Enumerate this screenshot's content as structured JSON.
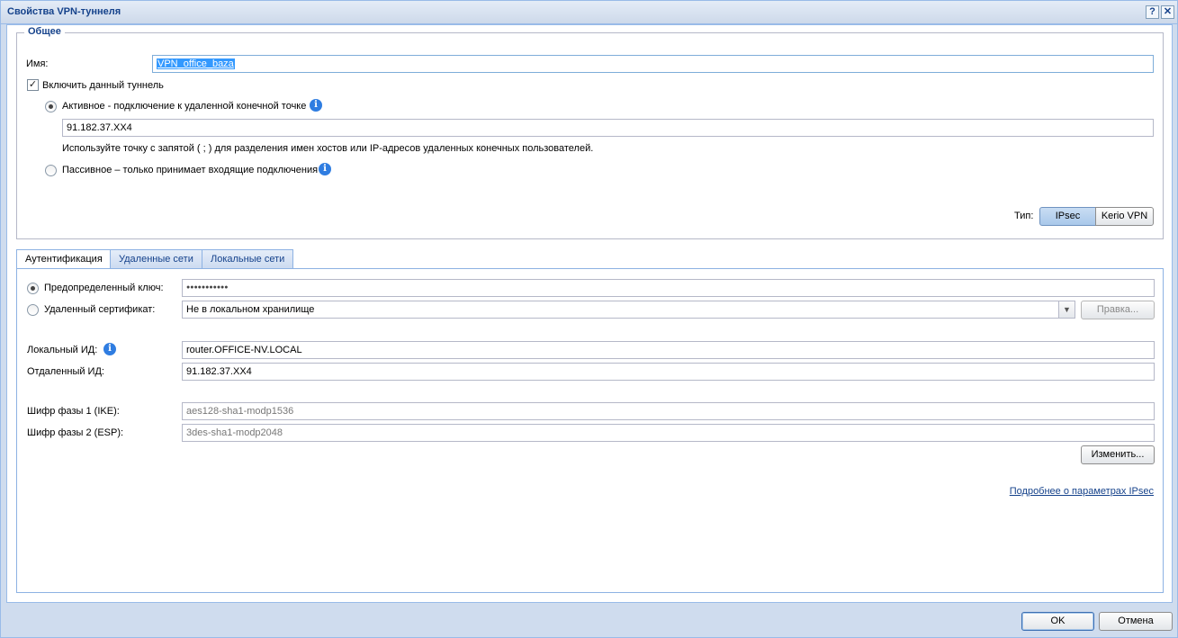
{
  "window": {
    "title": "Свойства VPN-туннеля",
    "help_glyph": "?",
    "close_glyph": "✕"
  },
  "general": {
    "legend": "Общее",
    "name_label": "Имя:",
    "name_value": "VPN_office_baza",
    "enable_label": "Включить данный туннель",
    "enable_checked": true,
    "active_label": "Активное - подключение к удаленной конечной точке",
    "active_selected": true,
    "remote_endpoint_value": "91.182.37.XX4",
    "hint": "Используйте точку с запятой ( ; ) для разделения имен хостов или IP-адресов удаленных конечных пользователей.",
    "passive_label": "Пассивное – только принимает входящие подключения",
    "passive_selected": false,
    "type_label": "Тип:",
    "type_options": [
      "IPsec",
      "Kerio VPN"
    ],
    "type_selected": "IPsec"
  },
  "tabs": [
    {
      "label": "Аутентификация",
      "active": true
    },
    {
      "label": "Удаленные сети",
      "active": false
    },
    {
      "label": "Локальные сети",
      "active": false
    }
  ],
  "auth": {
    "psk_label": "Предопределенный ключ:",
    "psk_value": "●●●●●●●●●●●",
    "psk_selected": true,
    "cert_label": "Удаленный сертификат:",
    "cert_value": "Не в локальном хранилище",
    "cert_selected": false,
    "edit_cert_button": "Правка...",
    "local_id_label": "Локальный ИД:",
    "local_id_value": "router.OFFICE-NV.LOCAL",
    "remote_id_label": "Отдаленный ИД:",
    "remote_id_value": "91.182.37.XX4",
    "phase1_label": "Шифр фазы 1 (IKE):",
    "phase1_value": "aes128-sha1-modp1536",
    "phase2_label": "Шифр фазы 2 (ESP):",
    "phase2_value": "3des-sha1-modp2048",
    "change_button": "Изменить...",
    "more_link": "Подробнее о параметрах IPsec"
  },
  "footer": {
    "ok_button": "OK",
    "cancel_button": "Отмена"
  },
  "colors": {
    "accent": "#15428b",
    "info_icon": "#2f7de1",
    "selection": "#3399ff"
  }
}
